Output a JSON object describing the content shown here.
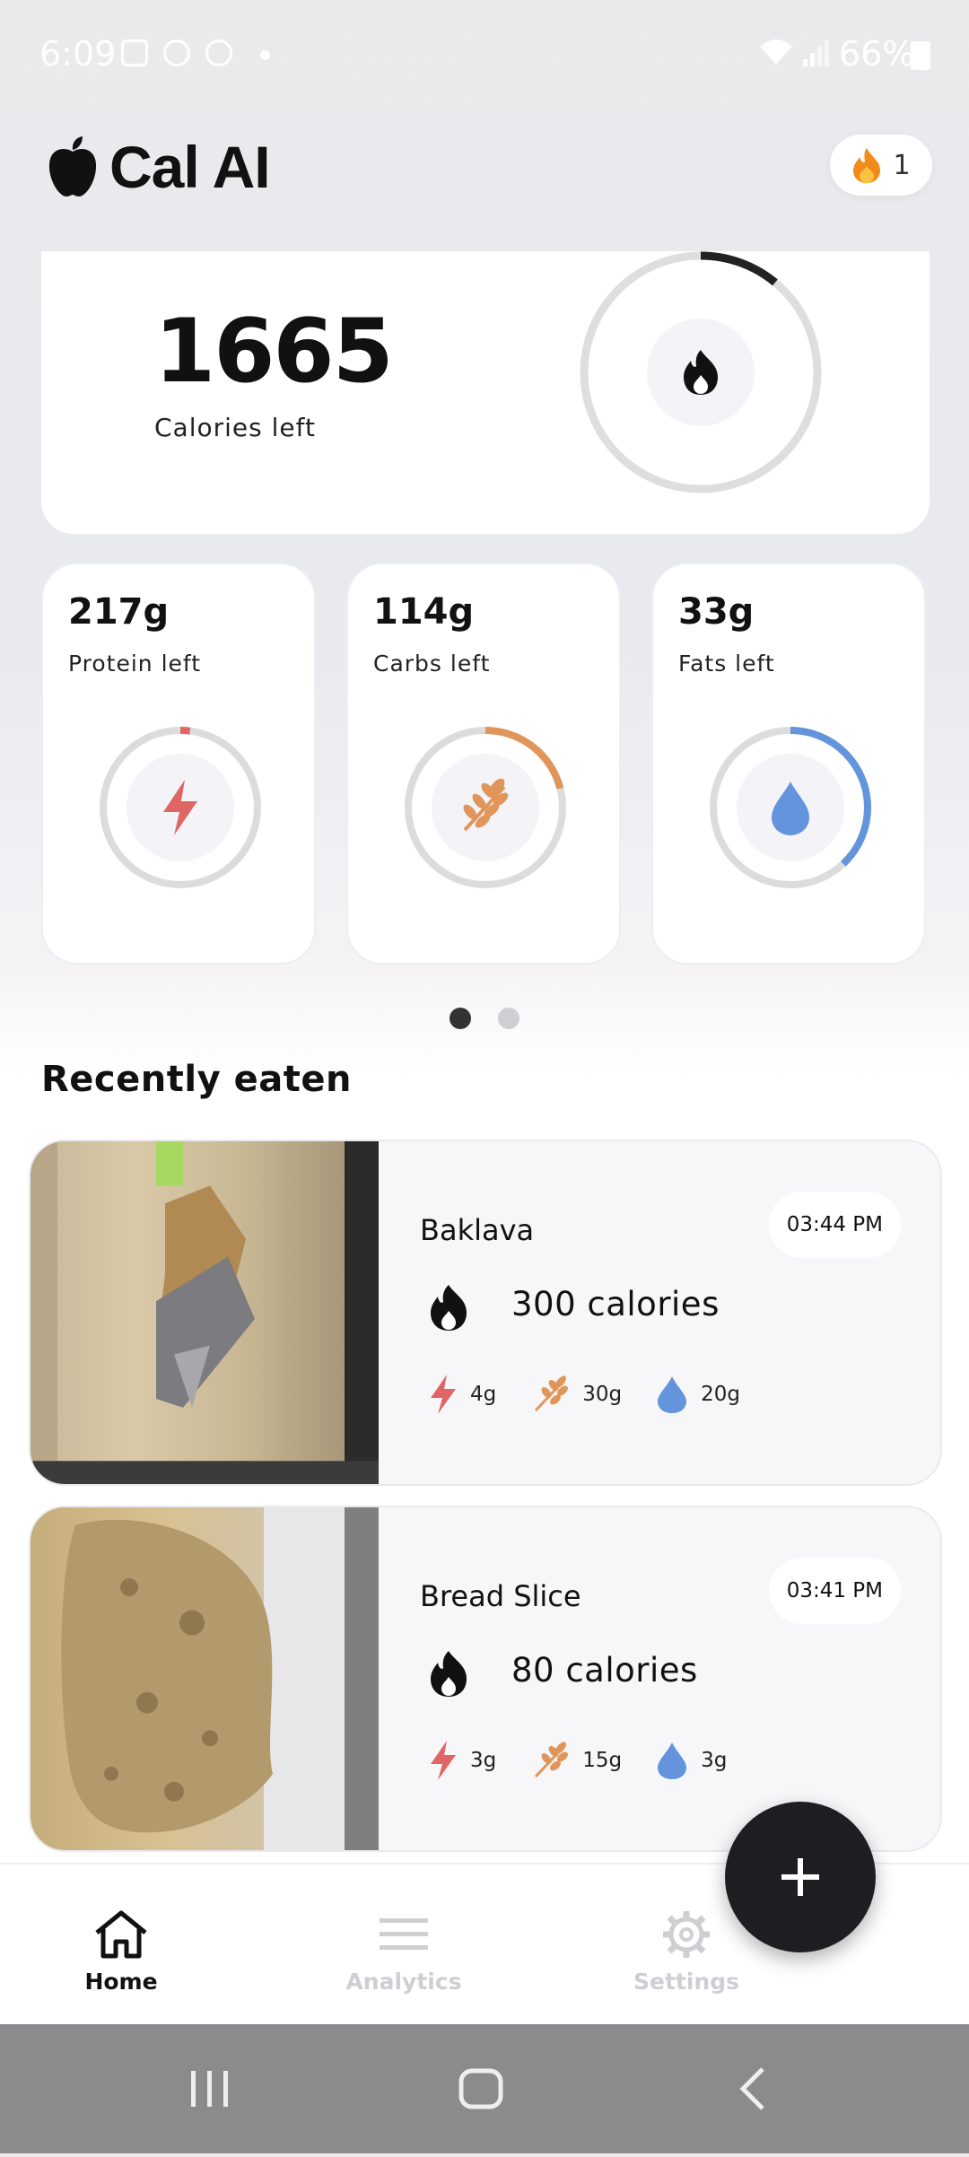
{
  "status_bar": {
    "time": "6:09",
    "battery": "66%"
  },
  "app": {
    "name": "Cal AI",
    "streak": "1"
  },
  "calories": {
    "value": "1665",
    "label": "Calories left",
    "progress": 0.11
  },
  "macros": [
    {
      "value": "217g",
      "label": "Protein left",
      "color": "#e06666",
      "progress": 0.02,
      "icon": "lightning-icon"
    },
    {
      "value": "114g",
      "label": "Carbs left",
      "color": "#e0965a",
      "progress": 0.21,
      "icon": "wheat-icon"
    },
    {
      "value": "33g",
      "label": "Fats left",
      "color": "#6495dc",
      "progress": 0.38,
      "icon": "drop-icon"
    }
  ],
  "pager": {
    "active": 0,
    "count": 2
  },
  "recent": {
    "title": "Recently eaten",
    "items": [
      {
        "name": "Baklava",
        "time": "03:44 PM",
        "calories": "300 calories",
        "protein": "4g",
        "carbs": "30g",
        "fats": "20g"
      },
      {
        "name": "Bread Slice",
        "time": "03:41 PM",
        "calories": "80 calories",
        "protein": "3g",
        "carbs": "15g",
        "fats": "3g"
      }
    ]
  },
  "nav": {
    "home": "Home",
    "analytics": "Analytics",
    "settings": "Settings"
  },
  "colors": {
    "accent": "#1d1d22",
    "protein": "#e06666",
    "carbs": "#e0965a",
    "fats": "#6495dc"
  }
}
